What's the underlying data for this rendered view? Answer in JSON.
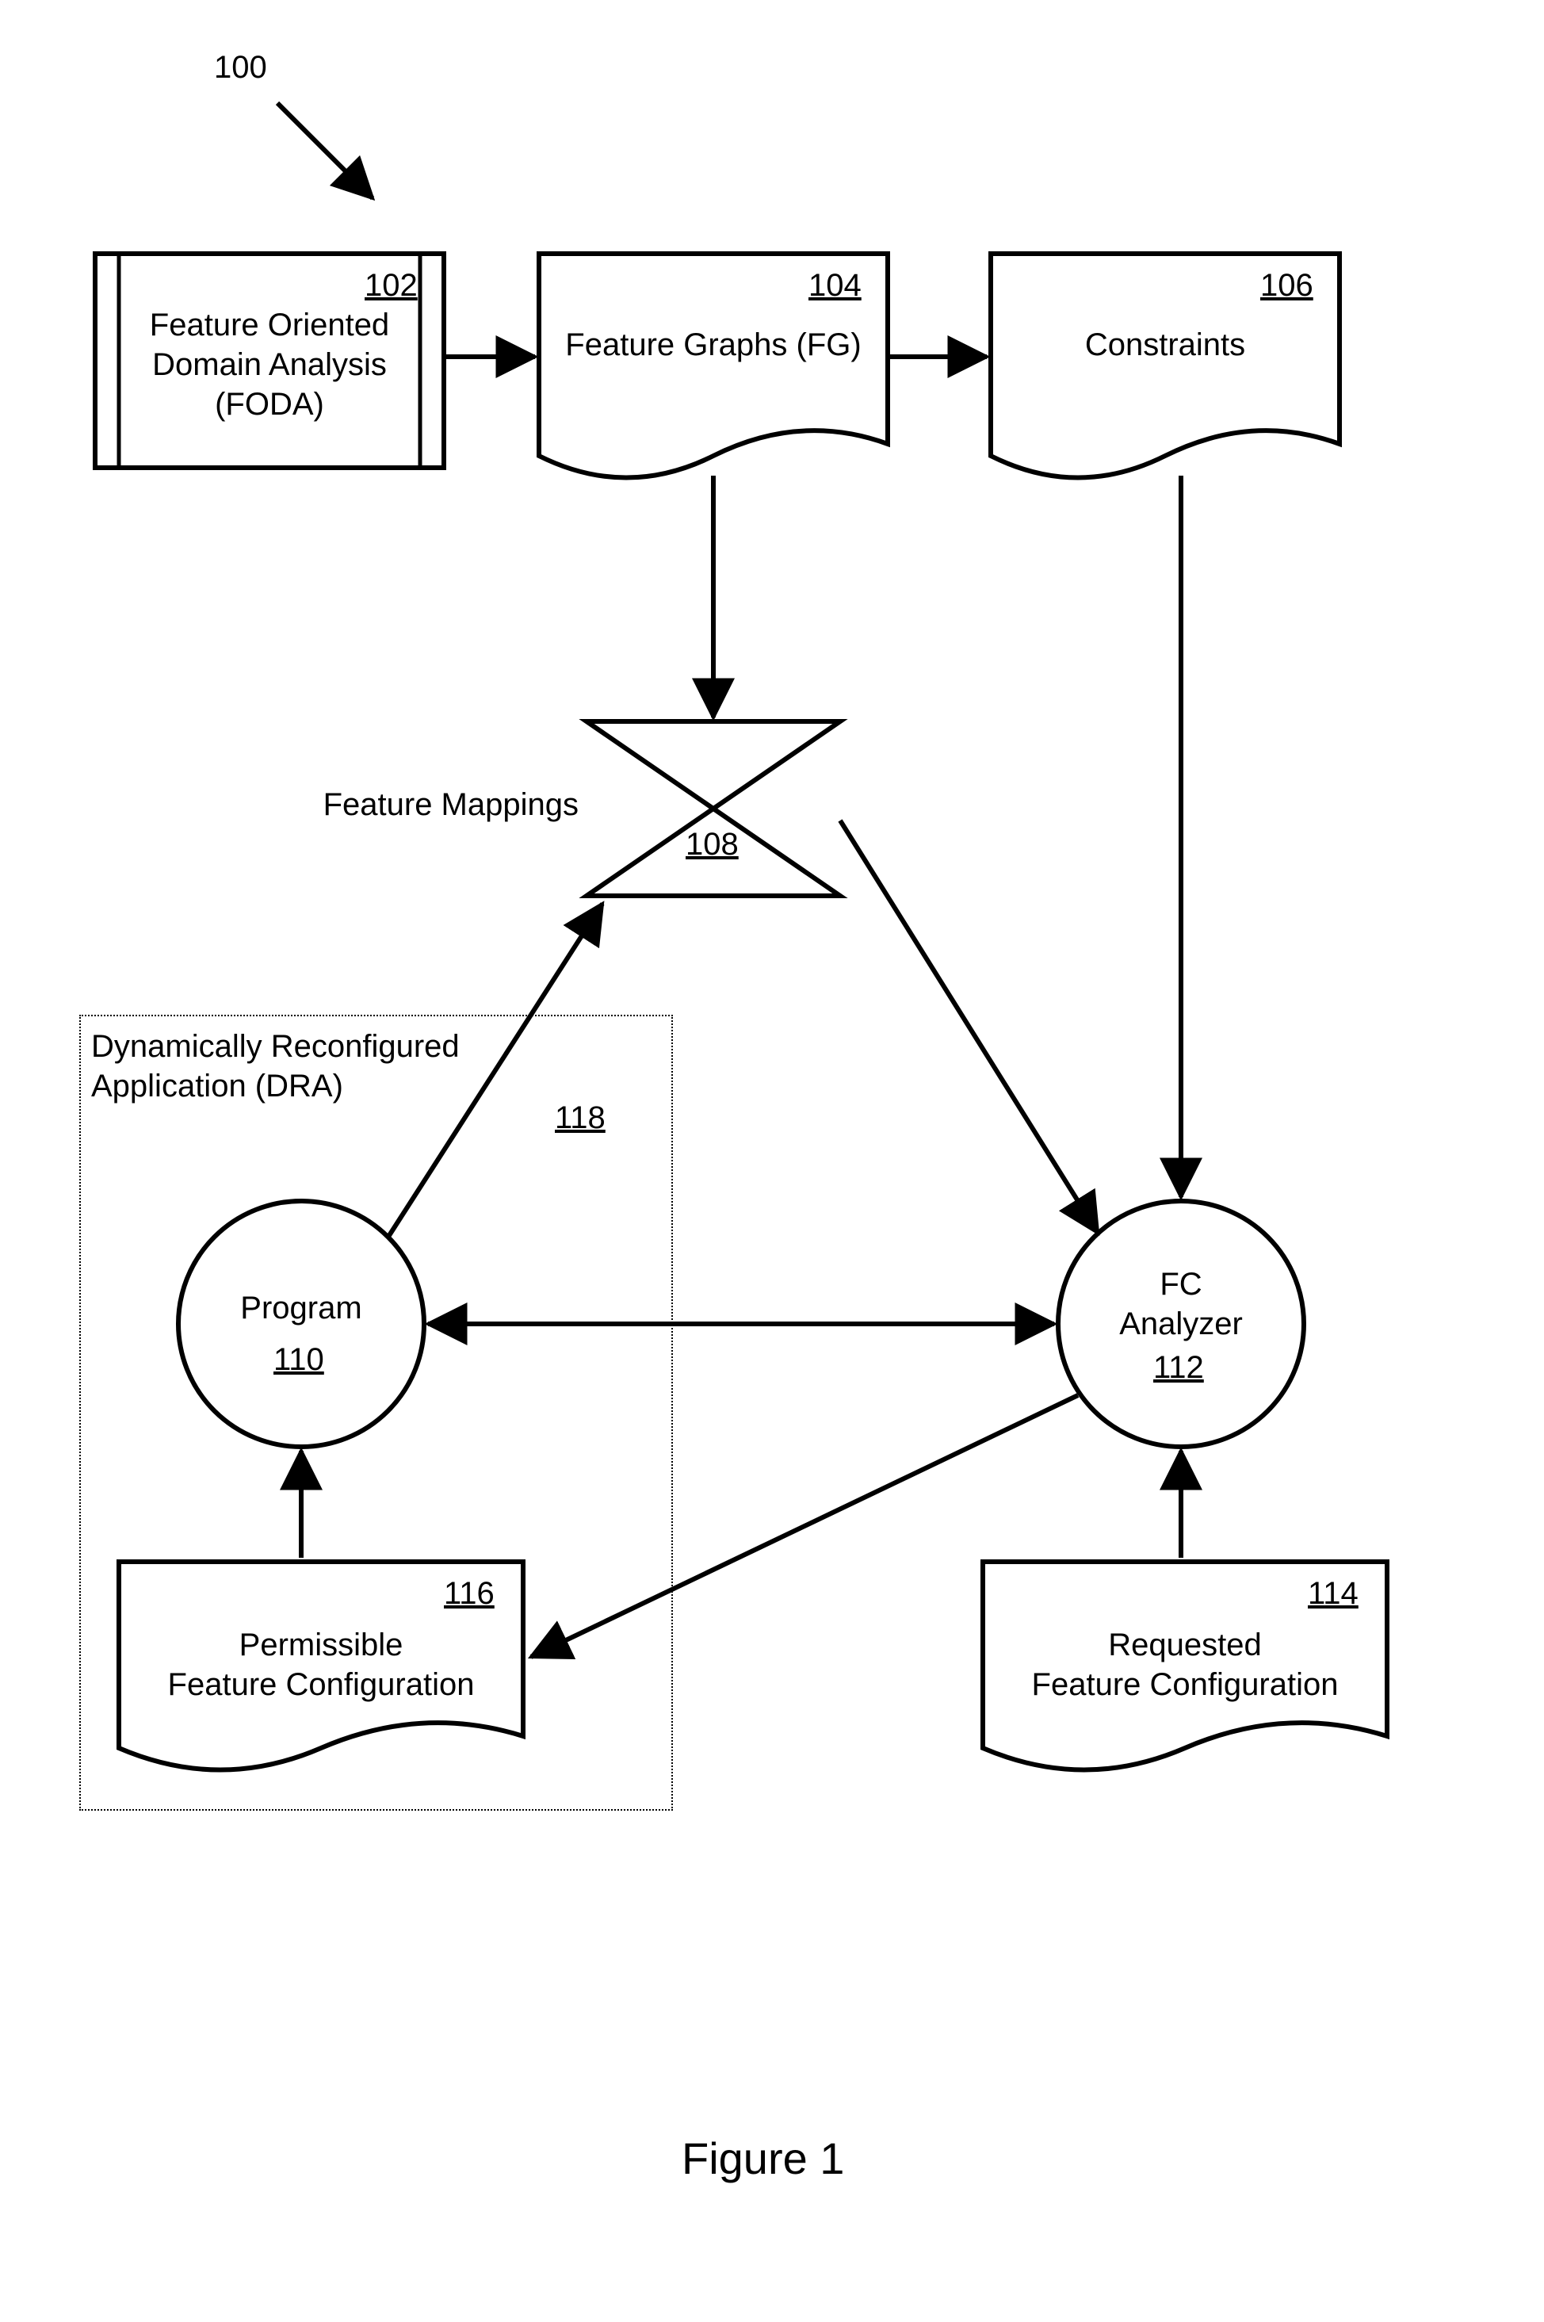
{
  "figure": {
    "number_label": "100",
    "caption": "Figure 1"
  },
  "nodes": {
    "foda": {
      "title": "Feature Oriented\nDomain Analysis\n(FODA)",
      "ref": "102"
    },
    "fg": {
      "title": "Feature Graphs (FG)",
      "ref": "104"
    },
    "constraints": {
      "title": "Constraints",
      "ref": "106"
    },
    "mappings": {
      "title": "Feature Mappings",
      "ref": "108"
    },
    "program": {
      "title": "Program",
      "ref": "110"
    },
    "fc_analyzer": {
      "title_line1": "FC",
      "title_line2": "Analyzer",
      "ref": "112"
    },
    "requested": {
      "title": "Requested\nFeature Configuration",
      "ref": "114"
    },
    "permissible": {
      "title": "Permissible\nFeature Configuration",
      "ref": "116"
    },
    "dra": {
      "title": "Dynamically Reconfigured\nApplication (DRA)",
      "ref": "118"
    }
  },
  "chart_data": {
    "type": "diagram",
    "title": "Figure 1",
    "nodes": [
      {
        "id": "102",
        "label": "Feature Oriented Domain Analysis (FODA)",
        "shape": "storage"
      },
      {
        "id": "104",
        "label": "Feature Graphs (FG)",
        "shape": "document"
      },
      {
        "id": "106",
        "label": "Constraints",
        "shape": "document"
      },
      {
        "id": "108",
        "label": "Feature Mappings",
        "shape": "bowtie"
      },
      {
        "id": "110",
        "label": "Program",
        "shape": "circle"
      },
      {
        "id": "112",
        "label": "FC Analyzer",
        "shape": "circle"
      },
      {
        "id": "114",
        "label": "Requested Feature Configuration",
        "shape": "document"
      },
      {
        "id": "116",
        "label": "Permissible Feature Configuration",
        "shape": "document"
      },
      {
        "id": "118",
        "label": "Dynamically Reconfigured Application (DRA)",
        "shape": "group"
      }
    ],
    "edges": [
      {
        "from": "102",
        "to": "104",
        "dir": "forward"
      },
      {
        "from": "104",
        "to": "106",
        "dir": "forward"
      },
      {
        "from": "104",
        "to": "108",
        "dir": "forward"
      },
      {
        "from": "106",
        "to": "112",
        "dir": "forward"
      },
      {
        "from": "108",
        "to": "112",
        "dir": "forward"
      },
      {
        "from": "110",
        "to": "108",
        "dir": "forward"
      },
      {
        "from": "110",
        "to": "112",
        "dir": "both"
      },
      {
        "from": "112",
        "to": "116",
        "dir": "forward"
      },
      {
        "from": "114",
        "to": "112",
        "dir": "forward"
      },
      {
        "from": "116",
        "to": "110",
        "dir": "forward"
      }
    ],
    "groups": [
      {
        "id": "118",
        "contains": [
          "110",
          "116"
        ]
      }
    ]
  }
}
